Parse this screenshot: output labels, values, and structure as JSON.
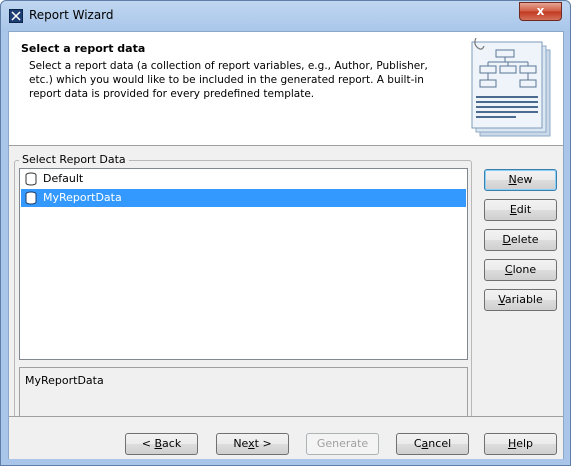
{
  "window": {
    "title": "Report Wizard",
    "close_label": "x"
  },
  "header": {
    "title": "Select a report data",
    "description": "Select a report data (a collection of report variables, e.g., Author, Publisher, etc.) which you would like to be included in the generated report. A built-in report data is provided for every predefined template."
  },
  "group": {
    "label": "Select Report Data",
    "items": [
      {
        "label": "Default",
        "selected": false
      },
      {
        "label": "MyReportData",
        "selected": true
      }
    ],
    "description_text": "MyReportData"
  },
  "side_buttons": {
    "new": {
      "pre": "",
      "mn": "N",
      "post": "ew"
    },
    "edit": {
      "pre": "",
      "mn": "E",
      "post": "dit"
    },
    "delete": {
      "pre": "",
      "mn": "D",
      "post": "elete"
    },
    "clone": {
      "pre": "",
      "mn": "C",
      "post": "lone"
    },
    "variable": {
      "pre": "",
      "mn": "V",
      "post": "ariable"
    }
  },
  "bottom_buttons": {
    "back": {
      "pre": "< ",
      "mn": "B",
      "post": "ack"
    },
    "next": {
      "pre": "Ne",
      "mn": "x",
      "post": "t >"
    },
    "generate": {
      "label": "Generate"
    },
    "cancel": {
      "pre": "C",
      "mn": "a",
      "post": "ncel"
    },
    "help": {
      "pre": "",
      "mn": "H",
      "post": "elp"
    }
  },
  "colors": {
    "selection": "#3399ff",
    "title_bar": "#a9c6ea",
    "close": "#c0391f"
  }
}
